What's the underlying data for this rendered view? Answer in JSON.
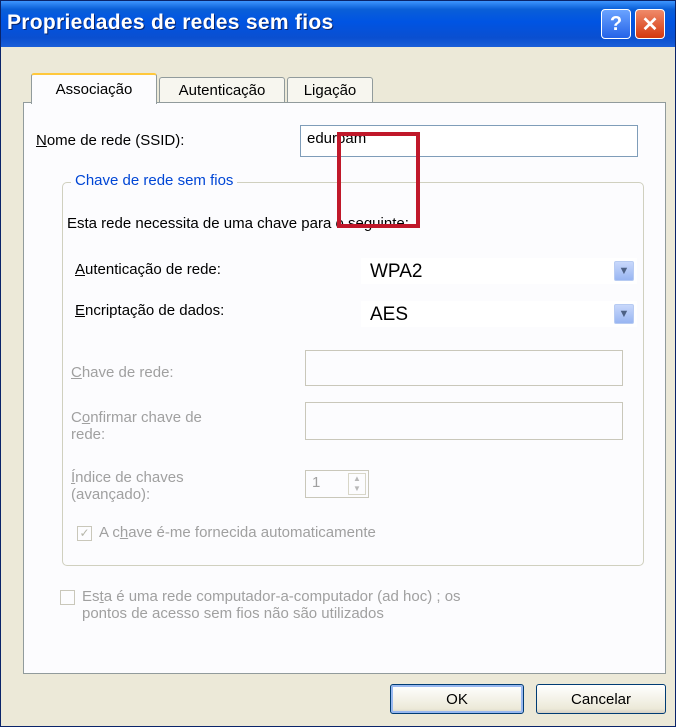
{
  "window": {
    "title": "Propriedades de redes sem fios",
    "help_icon": "?",
    "close_icon": "✕"
  },
  "tabs": [
    {
      "label": "Associação",
      "active": true
    },
    {
      "label": "Autenticação",
      "active": false
    },
    {
      "label": "Ligação",
      "active": false
    }
  ],
  "ssid": {
    "label_accel": "N",
    "label_rest": "ome de rede (SSID):",
    "value": "eduroam"
  },
  "group": {
    "title": "Chave de rede sem fios",
    "description": "Esta rede necessita de uma chave para o seguinte:",
    "auth": {
      "label_accel": "A",
      "label_rest": "utenticação de rede:",
      "value": "WPA2"
    },
    "encryption": {
      "label_accel": "E",
      "label_rest": "ncriptação de dados:",
      "value": "AES"
    },
    "network_key": {
      "label_accel": "C",
      "label_rest": "have de rede:",
      "value": ""
    },
    "confirm_key": {
      "label_line1_pre": "C",
      "label_line1_accel": "o",
      "label_line1_rest": "nfirmar chave de",
      "label_line2": "rede:",
      "value": ""
    },
    "key_index": {
      "label_accel": "Í",
      "label_line1_rest": "ndice de chaves",
      "label_line2": "(avançado):",
      "value": "1"
    },
    "auto_key": {
      "label_pre": "A c",
      "label_accel": "h",
      "label_rest": "ave é-me fornecida automaticamente",
      "checked": true
    }
  },
  "adhoc": {
    "line1_pre": "Es",
    "line1_accel": "t",
    "line1_rest": "a é uma rede computador-a-computador (ad hoc) ; os",
    "line2": "pontos de acesso sem fios não são utilizados",
    "checked": false
  },
  "buttons": {
    "ok": "OK",
    "cancel": "Cancelar"
  },
  "colors": {
    "titlebar": "#0054e3",
    "highlight_box": "#c0182a",
    "group_title": "#0046d5"
  }
}
